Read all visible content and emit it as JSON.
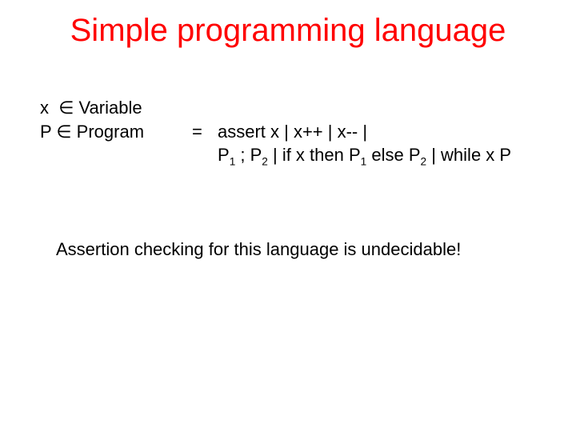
{
  "title": "Simple programming language",
  "grammar": {
    "var_line": "x  ∈ Variable",
    "prog_lhs": "P ∈ Program",
    "eq": "=",
    "rhs_line1_pre": "assert x | x++ | x-- |",
    "rhs_line2": {
      "p1": "P",
      "s1": "1",
      "sep1": " ; ",
      "p2": "P",
      "s2": "2",
      "mid": " | if x then ",
      "p3": "P",
      "s3": "1",
      "else": " else ",
      "p4": "P",
      "s4": "2",
      "tail": " | while x P"
    }
  },
  "assertion": "Assertion checking for this language is undecidable!"
}
